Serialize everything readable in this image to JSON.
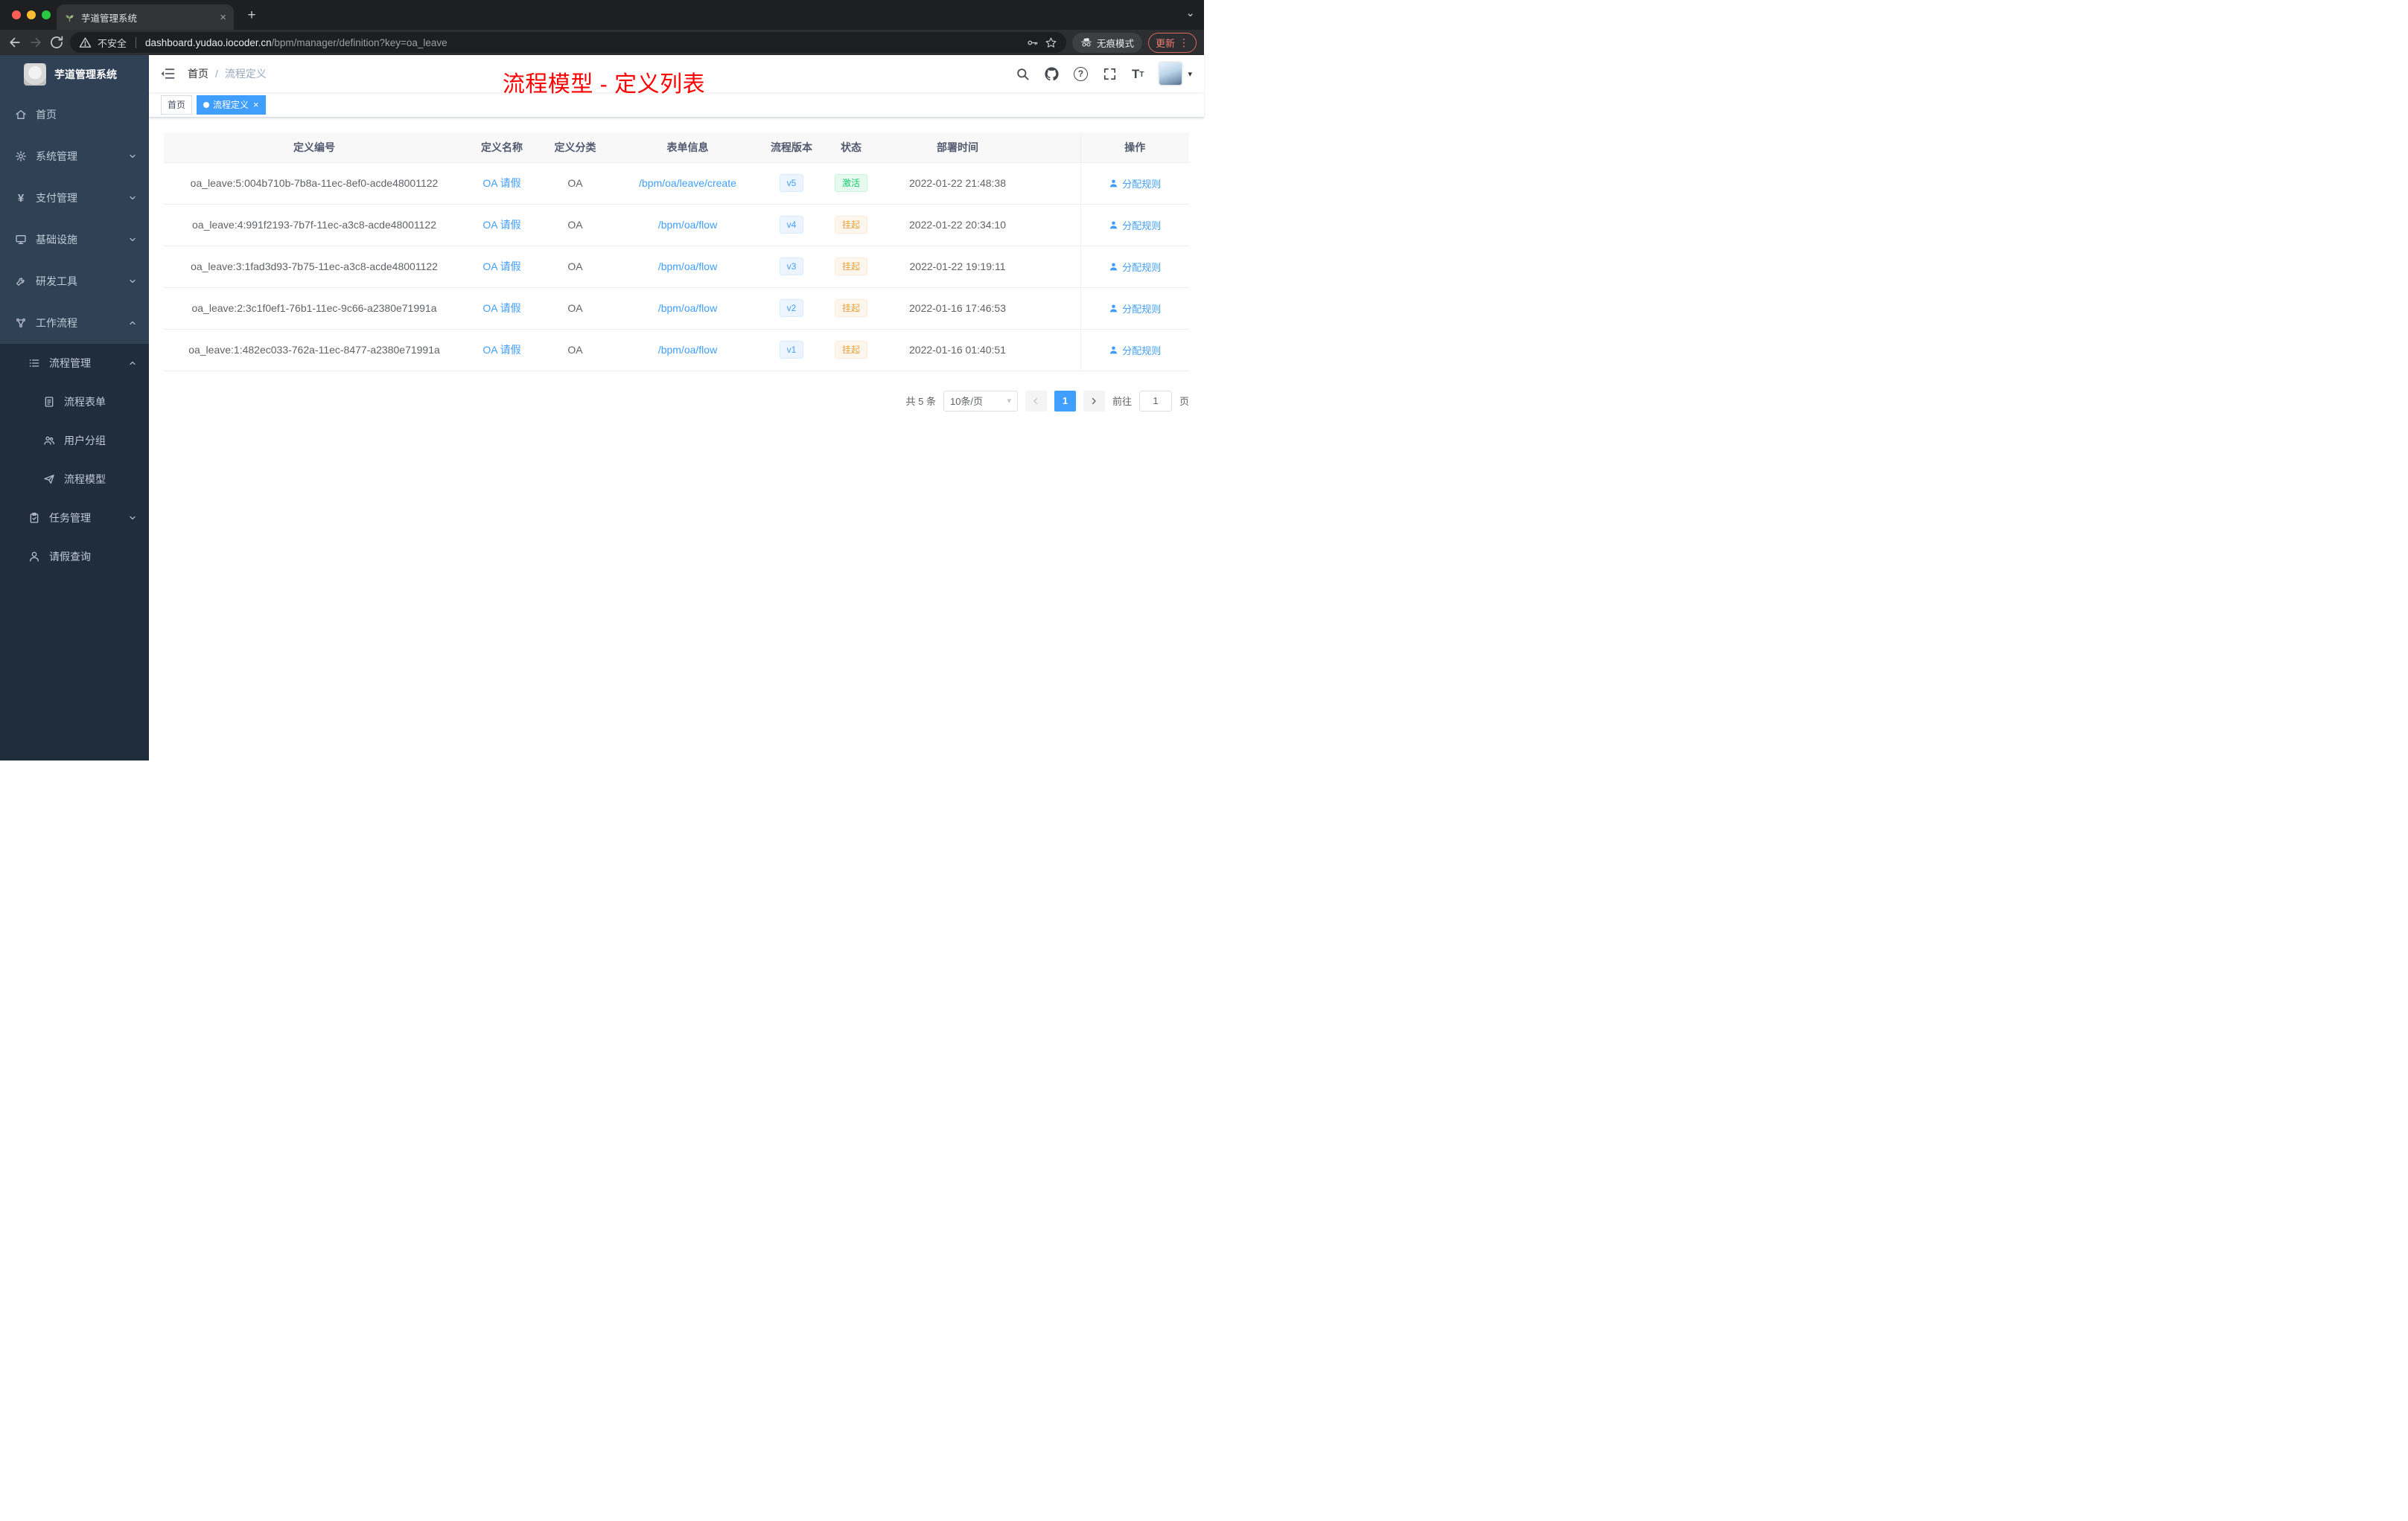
{
  "browser": {
    "tab_title": "芋道管理系统",
    "security_label": "不安全",
    "url_host": "dashboard.yudao.iocoder.cn",
    "url_path": "/bpm/manager/definition?key=oa_leave",
    "incognito_label": "无痕模式",
    "update_label": "更新"
  },
  "icons": {
    "tab_close": "×",
    "tag_close": "×",
    "new_tab": "+",
    "tab_search": "⌄",
    "more_vertical": "⋮",
    "caret_down": "▾",
    "breadcrumb_separator": "/"
  },
  "sidebar": {
    "brand": "芋道管理系统",
    "items": [
      {
        "label": "首页"
      },
      {
        "label": "系统管理"
      },
      {
        "label": "支付管理"
      },
      {
        "label": "基础设施"
      },
      {
        "label": "研发工具"
      },
      {
        "label": "工作流程"
      }
    ],
    "workflow": {
      "process_mgmt": "流程管理",
      "children": [
        "流程表单",
        "用户分组",
        "流程模型"
      ],
      "task_mgmt": "任务管理",
      "leave_query": "请假查询"
    }
  },
  "navbar": {
    "breadcrumb": [
      "首页",
      "流程定义"
    ]
  },
  "annotation": {
    "text": "流程模型 - 定义列表",
    "color": "#ff0000"
  },
  "tags": [
    {
      "label": "首页",
      "active": false
    },
    {
      "label": "流程定义",
      "active": true
    }
  ],
  "table": {
    "headers": [
      "定义编号",
      "定义名称",
      "定义分类",
      "表单信息",
      "流程版本",
      "状态",
      "部署时间",
      "操作"
    ],
    "rows": [
      {
        "id": "oa_leave:5:004b710b-7b8a-11ec-8ef0-acde48001122",
        "name": "OA 请假",
        "category": "OA",
        "form": "/bpm/oa/leave/create",
        "version": "v5",
        "status": "激活",
        "status_type": "success",
        "deploy_time": "2022-01-22 21:48:38",
        "action": "分配规则"
      },
      {
        "id": "oa_leave:4:991f2193-7b7f-11ec-a3c8-acde48001122",
        "name": "OA 请假",
        "category": "OA",
        "form": "/bpm/oa/flow",
        "version": "v4",
        "status": "挂起",
        "status_type": "warning",
        "deploy_time": "2022-01-22 20:34:10",
        "action": "分配规则"
      },
      {
        "id": "oa_leave:3:1fad3d93-7b75-11ec-a3c8-acde48001122",
        "name": "OA 请假",
        "category": "OA",
        "form": "/bpm/oa/flow",
        "version": "v3",
        "status": "挂起",
        "status_type": "warning",
        "deploy_time": "2022-01-22 19:19:11",
        "action": "分配规则"
      },
      {
        "id": "oa_leave:2:3c1f0ef1-76b1-11ec-9c66-a2380e71991a",
        "name": "OA 请假",
        "category": "OA",
        "form": "/bpm/oa/flow",
        "version": "v2",
        "status": "挂起",
        "status_type": "warning",
        "deploy_time": "2022-01-16 17:46:53",
        "action": "分配规则"
      },
      {
        "id": "oa_leave:1:482ec033-762a-11ec-8477-a2380e71991a",
        "name": "OA 请假",
        "category": "OA",
        "form": "/bpm/oa/flow",
        "version": "v1",
        "status": "挂起",
        "status_type": "warning",
        "deploy_time": "2022-01-16 01:40:51",
        "action": "分配规则"
      }
    ]
  },
  "pagination": {
    "total": "共 5 条",
    "page_size": "10条/页",
    "current": "1",
    "goto_label": "前往",
    "goto_value": "1",
    "goto_unit": "页"
  },
  "colors": {
    "accent": "#409eff",
    "success": "#13ce66",
    "warning": "#e6a23c",
    "annotation_red": "#ff0000",
    "sidebar_bg": "#304156",
    "submenu_bg": "#1f2d3d"
  }
}
